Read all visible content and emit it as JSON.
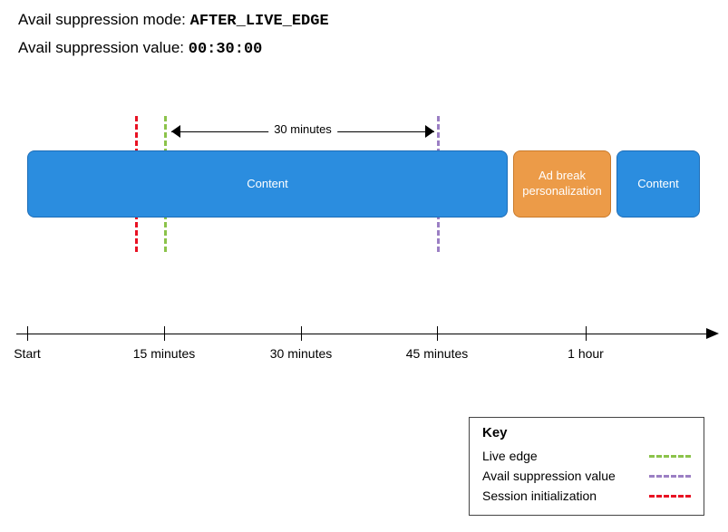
{
  "header": {
    "mode_label": "Avail suppression mode: ",
    "mode_value": "AFTER_LIVE_EDGE",
    "value_label": "Avail suppression value: ",
    "value_value": "00:30:00"
  },
  "span_label": "30 minutes",
  "blocks": {
    "content1": "Content",
    "ad": "Ad break\npersonalization",
    "content2": "Content"
  },
  "axis": {
    "start": "Start",
    "t15": "15 minutes",
    "t30": "30 minutes",
    "t45": "45 minutes",
    "t60": "1 hour"
  },
  "legend": {
    "title": "Key",
    "live": "Live edge",
    "avail": "Avail suppression value",
    "session": "Session initialization"
  }
}
